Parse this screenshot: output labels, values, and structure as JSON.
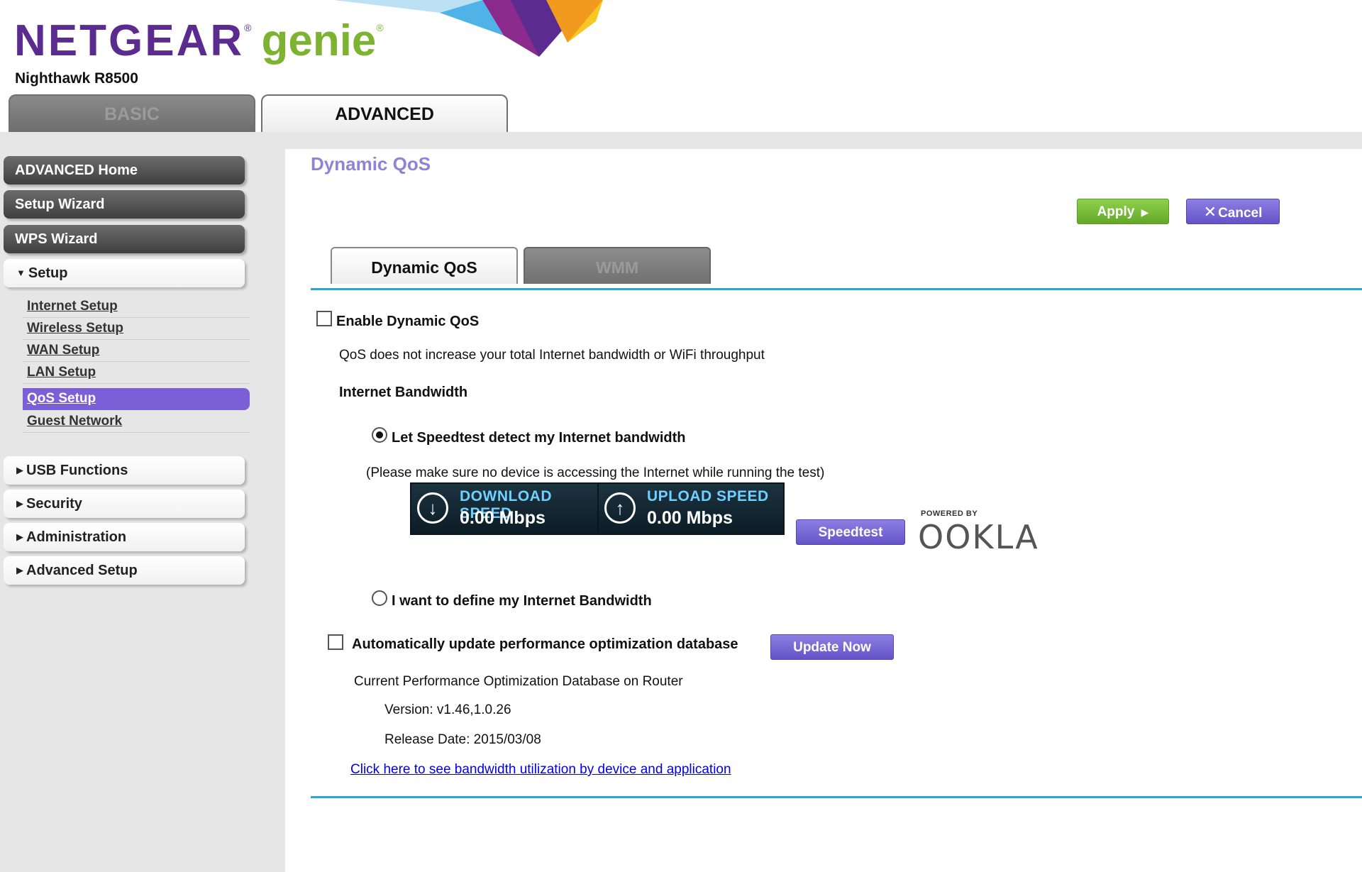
{
  "header": {
    "brand": "NETGEAR",
    "product": "genie",
    "model": "Nighthawk R8500",
    "tabs": {
      "basic": "BASIC",
      "advanced": "ADVANCED"
    }
  },
  "sidebar": {
    "advanced_home": "ADVANCED Home",
    "setup_wizard": "Setup Wizard",
    "wps_wizard": "WPS Wizard",
    "setup": "Setup",
    "setup_items": [
      "Internet Setup",
      "Wireless Setup",
      "WAN Setup",
      "LAN Setup",
      "QoS Setup",
      "Guest Network"
    ],
    "usb_functions": "USB Functions",
    "security": "Security",
    "administration": "Administration",
    "advanced_setup": "Advanced Setup"
  },
  "main": {
    "title": "Dynamic QoS",
    "apply": "Apply",
    "cancel": "Cancel",
    "tabs": {
      "dynamic_qos": "Dynamic QoS",
      "wmm": "WMM"
    },
    "enable_label": "Enable Dynamic QoS",
    "qos_note": "QoS does not increase your total Internet bandwidth or WiFi throughput",
    "bandwidth_heading": "Internet Bandwidth",
    "radio_speedtest": "Let Speedtest detect my Internet bandwidth",
    "speedtest_note": "(Please make sure no device is accessing the Internet while running the test)",
    "download_label": "DOWNLOAD SPEED",
    "download_value": "0.00 Mbps",
    "upload_label": "UPLOAD SPEED",
    "upload_value": "0.00 Mbps",
    "speedtest_button": "Speedtest",
    "ookla_powered": "POWERED BY",
    "ookla_word": "OOKLA",
    "radio_define": "I want to define my Internet Bandwidth",
    "auto_update_label": "Automatically update performance optimization database",
    "update_button": "Update Now",
    "db_heading": "Current Performance Optimization Database on Router",
    "version": "Version: v1.46,1.0.26",
    "release_date": "Release Date: 2015/03/08",
    "link": "Click here to see bandwidth utilization by device and application"
  },
  "colors": {
    "brand_purple": "#5b2b8f",
    "genie_green": "#7cb330",
    "accent_blue": "#2aa6d1",
    "button_purple": "#6553c7",
    "apply_green": "#64a82a",
    "active_item": "#7b5fd6"
  }
}
